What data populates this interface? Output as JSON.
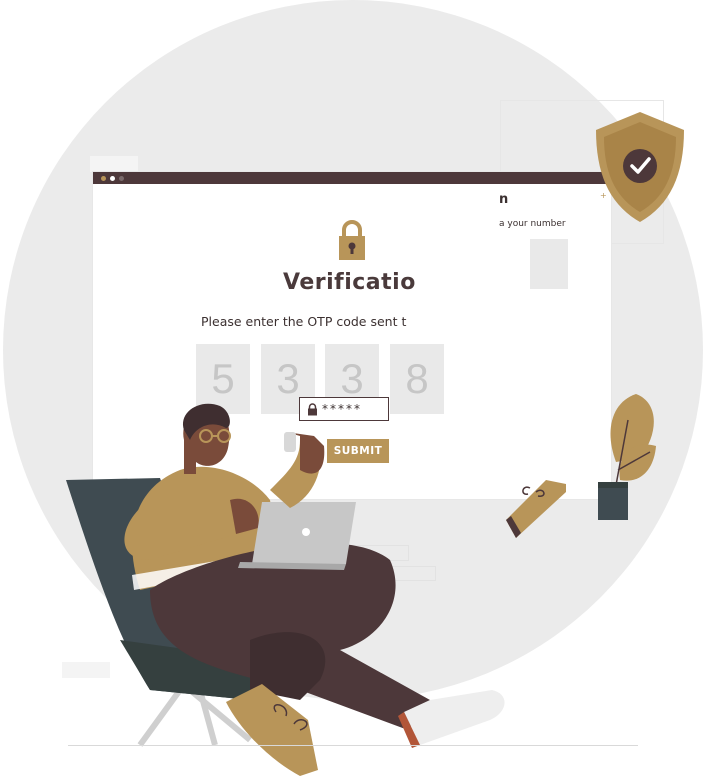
{
  "illustration": {
    "heading": "Verificatio",
    "instruction": "Please enter the OTP code sent t",
    "otp_digits": [
      "5",
      "3",
      "3",
      "8"
    ],
    "submit_label": "SUBMIT",
    "password_mask": "*****",
    "side_panel_heading": "n",
    "side_panel_text": "a your number",
    "icons": [
      "padlock-icon",
      "shield-check-icon",
      "lock-small-icon"
    ],
    "colors": {
      "accent_gold": "#b89559",
      "dark_brown": "#4d383a",
      "chair": "#3f4b51",
      "background_circle": "#ebebeb"
    }
  }
}
